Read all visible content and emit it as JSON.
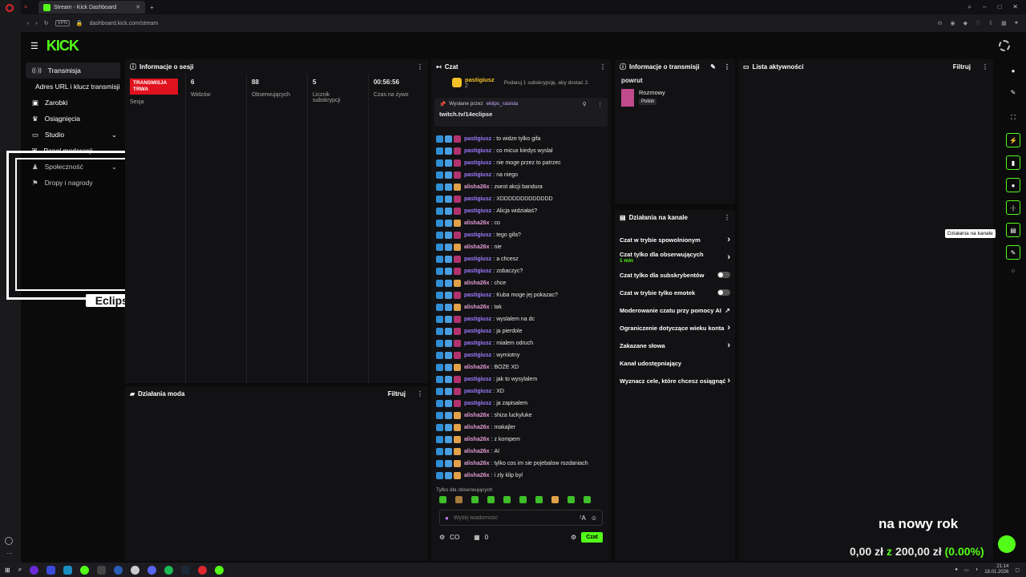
{
  "browser": {
    "tab_title": "Stream - Kick Dashboard",
    "url": "dashboard.kick.com/stream",
    "vpn": "VPN"
  },
  "logo": "KICK",
  "sidebar": {
    "items": [
      {
        "label": "Transmisja"
      },
      {
        "label": "Adres URL i klucz transmisji"
      },
      {
        "label": "Zarobki"
      },
      {
        "label": "Osiągnięcia"
      },
      {
        "label": "Studio"
      },
      {
        "label": "Panel moderacji"
      },
      {
        "label": "Społeczność"
      },
      {
        "label": "Dropy i nagrody"
      }
    ]
  },
  "overlay": {
    "name": "EclipsE"
  },
  "session": {
    "title": "Informacje o sesji",
    "status": "TRANSMISJA TRWA",
    "status_label": "Sesja",
    "stats": [
      {
        "value": "6",
        "label": "Widzów"
      },
      {
        "value": "88",
        "label": "Obserwujących"
      },
      {
        "value": "5",
        "label": "Licznik subskrypcji"
      },
      {
        "value": "00:56:56",
        "label": "Czas na żywo"
      }
    ]
  },
  "mod_actions": {
    "title": "Działania moda",
    "filter": "Filtruj"
  },
  "chat": {
    "title": "Czat",
    "sub_user": "pastigiusz",
    "sub_count": "2",
    "sub_text": "Podaruj 1 subskrypcję, aby dostać 2.",
    "pinned_by_label": "Wysłane przez",
    "pinned_by": "eklips_rasista",
    "pinned_text": "twitch.tv/14eclipse",
    "messages": [
      {
        "user": "pastigiusz",
        "text": "to widze tylko gifa",
        "color": "#9b7bff"
      },
      {
        "user": "pastigiusz",
        "text": "co micux kiedys wyslal",
        "color": "#9b7bff"
      },
      {
        "user": "pastigiusz",
        "text": "nie moge przez to patrzec",
        "color": "#9b7bff"
      },
      {
        "user": "pastigiusz",
        "text": "na niego",
        "color": "#9b7bff"
      },
      {
        "user": "alisha26x",
        "text": "zwrot akcji bandura",
        "color": "#e39bd6"
      },
      {
        "user": "pastigiusz",
        "text": "XDDDDDDDDDDDDD",
        "color": "#9b7bff"
      },
      {
        "user": "pastigiusz",
        "text": "Alicja widziałaś?",
        "color": "#9b7bff"
      },
      {
        "user": "alisha26x",
        "text": "co",
        "color": "#e39bd6"
      },
      {
        "user": "pastigiusz",
        "text": "tego gifa?",
        "color": "#9b7bff"
      },
      {
        "user": "alisha26x",
        "text": "nie",
        "color": "#e39bd6"
      },
      {
        "user": "pastigiusz",
        "text": "a chcesz",
        "color": "#9b7bff"
      },
      {
        "user": "pastigiusz",
        "text": "zobaczyc?",
        "color": "#9b7bff"
      },
      {
        "user": "alisha26x",
        "text": "chce",
        "color": "#e39bd6"
      },
      {
        "user": "pastigiusz",
        "text": "Kuba moge jej pokazac?",
        "color": "#9b7bff"
      },
      {
        "user": "alisha26x",
        "text": "tak",
        "color": "#e39bd6"
      },
      {
        "user": "pastigiusz",
        "text": "wyslalem na dc",
        "color": "#9b7bff"
      },
      {
        "user": "pastigiusz",
        "text": "ja pierdole",
        "color": "#9b7bff"
      },
      {
        "user": "pastigiusz",
        "text": "mialem odruch",
        "color": "#9b7bff"
      },
      {
        "user": "pastigiusz",
        "text": "wymiotny",
        "color": "#9b7bff"
      },
      {
        "user": "alisha26x",
        "text": "BOZE XD",
        "color": "#e39bd6"
      },
      {
        "user": "pastigiusz",
        "text": "jak to wysylalem",
        "color": "#9b7bff"
      },
      {
        "user": "pastigiusz",
        "text": "XD",
        "color": "#9b7bff"
      },
      {
        "user": "pastigiusz",
        "text": "ja zapisalem",
        "color": "#9b7bff"
      },
      {
        "user": "alisha26x",
        "text": "shiza luckyluke",
        "color": "#e39bd6"
      },
      {
        "user": "alisha26x",
        "text": "makajler",
        "color": "#e39bd6"
      },
      {
        "user": "alisha26x",
        "text": "z kompem",
        "color": "#e39bd6"
      },
      {
        "user": "alisha26x",
        "text": "AI",
        "color": "#e39bd6"
      },
      {
        "user": "alisha26x",
        "text": "tylko cos im sie pojebalow rozdaniach",
        "color": "#e39bd6"
      },
      {
        "user": "alisha26x",
        "text": "i zly klip byl",
        "color": "#e39bd6"
      }
    ],
    "followers_only": "Tylko dla obserwujących",
    "placeholder": "Wyślij wiadomość",
    "points": "CO",
    "count": "0",
    "send": "Czat"
  },
  "stream_info": {
    "title": "Informacje o transmisji",
    "stream_title": "powrut",
    "category": "Rozmowy",
    "tag": "Polish"
  },
  "channel_actions": {
    "title": "Działania na kanale",
    "items": [
      {
        "label": "Czat w trybie spowolnionym",
        "sub": "",
        "ctrl": "arrow"
      },
      {
        "label": "Czat tylko dla obserwujących",
        "sub": "1 min",
        "ctrl": "arrow"
      },
      {
        "label": "Czat tylko dla subskrybentów",
        "sub": "",
        "ctrl": "toggle"
      },
      {
        "label": "Czat w trybie tylko emotek",
        "sub": "",
        "ctrl": "toggle"
      },
      {
        "label": "Moderowanie czatu przy pomocy AI",
        "sub": "",
        "ctrl": "ext"
      },
      {
        "label": "Ograniczenie dotyczące wieku konta",
        "sub": "",
        "ctrl": "arrow"
      },
      {
        "label": "Zakazane słowa",
        "sub": "",
        "ctrl": "arrow"
      },
      {
        "label": "Kanał udostępniający",
        "sub": "",
        "ctrl": ""
      },
      {
        "label": "Wyznacz cele, które chcesz osiągnąć",
        "sub": "",
        "ctrl": "arrow"
      }
    ]
  },
  "activity": {
    "title": "Lista aktywności",
    "filter": "Filtruj"
  },
  "tooltip": "Działania na kanale",
  "goal": {
    "title": "na nowy rok",
    "current": "0,00 zł",
    "z": "z",
    "target": "200,00 zł",
    "percent": "(0.00%)"
  },
  "clock": {
    "time": "21:14",
    "date": "18.01.2026"
  }
}
